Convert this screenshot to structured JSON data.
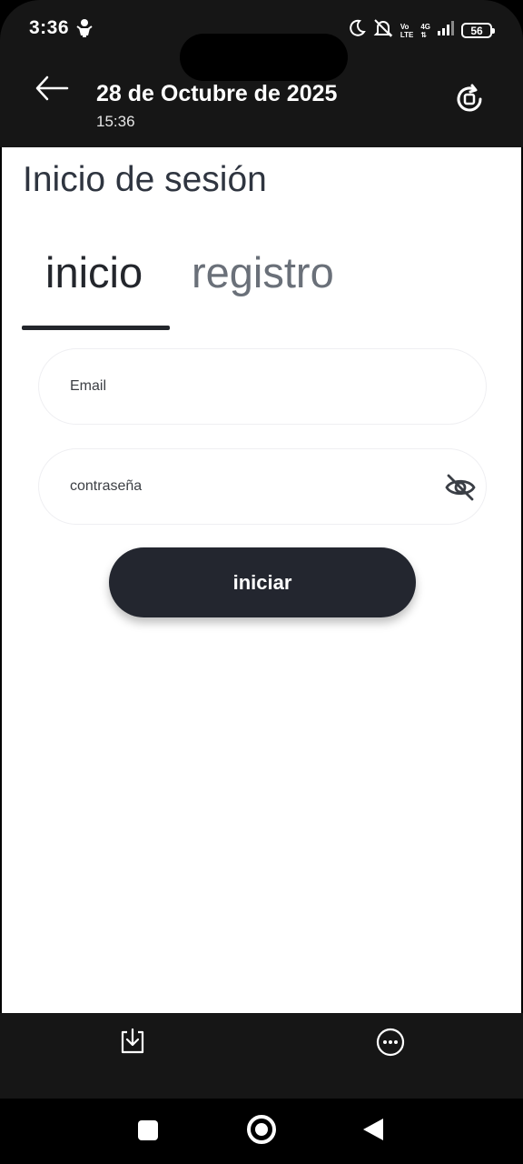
{
  "status_bar": {
    "time": "3:36",
    "network_top": "Vo",
    "network_bottom": "LTE",
    "signal_top": "4G",
    "battery": "56"
  },
  "header": {
    "title": "28 de Octubre de 2025",
    "subtitle": "15:36"
  },
  "page": {
    "title": "Inicio de sesión"
  },
  "tabs": [
    {
      "label": "inicio",
      "active": true
    },
    {
      "label": "registro",
      "active": false
    }
  ],
  "form": {
    "email_placeholder": "Email",
    "password_placeholder": "contraseña",
    "submit_label": "iniciar"
  },
  "colors": {
    "dark": "#23262f",
    "header_bg": "#161616",
    "tab_inactive": "#6a7079"
  },
  "icons": {
    "back": "arrow-left-icon",
    "rotate": "screen-rotate-icon",
    "eye": "eye-off-icon",
    "download": "download-icon",
    "more": "more-horizontal-icon"
  }
}
